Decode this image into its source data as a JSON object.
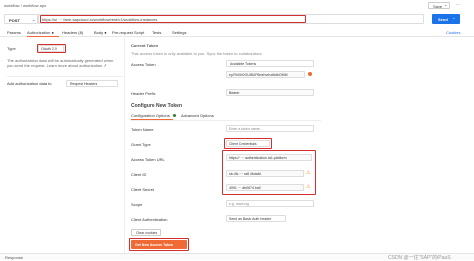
{
  "breadcrumb": {
    "workspace": "workflow",
    "separator": "/",
    "request": "workflow apo"
  },
  "header_actions": {
    "save_label": "Save",
    "caret": "⌄",
    "more": "···"
  },
  "request": {
    "method": "POST",
    "url": "https://s/ ··· farm.sapcloud.io/workflow/rest/v1/workflow-instances",
    "send_label": "Send",
    "cookies_label": "Cookies"
  },
  "tabs": [
    "Params",
    "Authorization ●",
    "Headers (8)",
    "Body ●",
    "Pre-request Script",
    "Tests",
    "Settings"
  ],
  "left": {
    "type_label": "Type",
    "type_value": "OAuth 2.0",
    "type_desc": "The authorization data will be automatically generated when you send the request. Learn more about authorization ↗",
    "add_data_label": "Add authorization data to",
    "add_data_value": "Request Headers"
  },
  "current_token": {
    "heading": "Current Token",
    "desc": "This access token is only available to you. Sync the token to collaborators.",
    "access_token_label": "Access Token",
    "access_token_value": "Available Tokens",
    "token_value": "ey.Rh0hOOUt5UP6mrhvrhzt6dbOMM",
    "header_prefix_label": "Header Prefix",
    "header_prefix_value": "Bearer"
  },
  "new_token": {
    "heading": "Configure New Token",
    "subtab_config": "Configuration Options",
    "subtab_advanced": "Advanced Options",
    "token_name_label": "Token Name",
    "token_name_placeholder": "Enter a token name...",
    "grant_type_label": "Grant Type",
    "grant_type_value": "Client Credentials",
    "access_token_url_label": "Access Token URL",
    "access_token_url_value": "https:// ··· authentication.ra1-platform",
    "client_id_label": "Client ID",
    "client_id_value": "sb-4fc ··· ra8 4bdafd",
    "client_secret_label": "Client Secret",
    "client_secret_value": "4091 ··· db0674 ba0",
    "scope_label": "Scope",
    "scope_placeholder": "e.g. read:org",
    "client_auth_label": "Client Authentication",
    "client_auth_value": "Send as Basic Auth header",
    "clear_cookies_label": "Clear cookies",
    "get_token_label": "Get New Access Token"
  },
  "footer": {
    "left_label": "Response",
    "watermark": "CSDN @一往\"SAP\"的iPaaS"
  },
  "colors": {
    "accent": "#f06a35",
    "send": "#1a73e8",
    "highlight": "#d32f2f"
  }
}
